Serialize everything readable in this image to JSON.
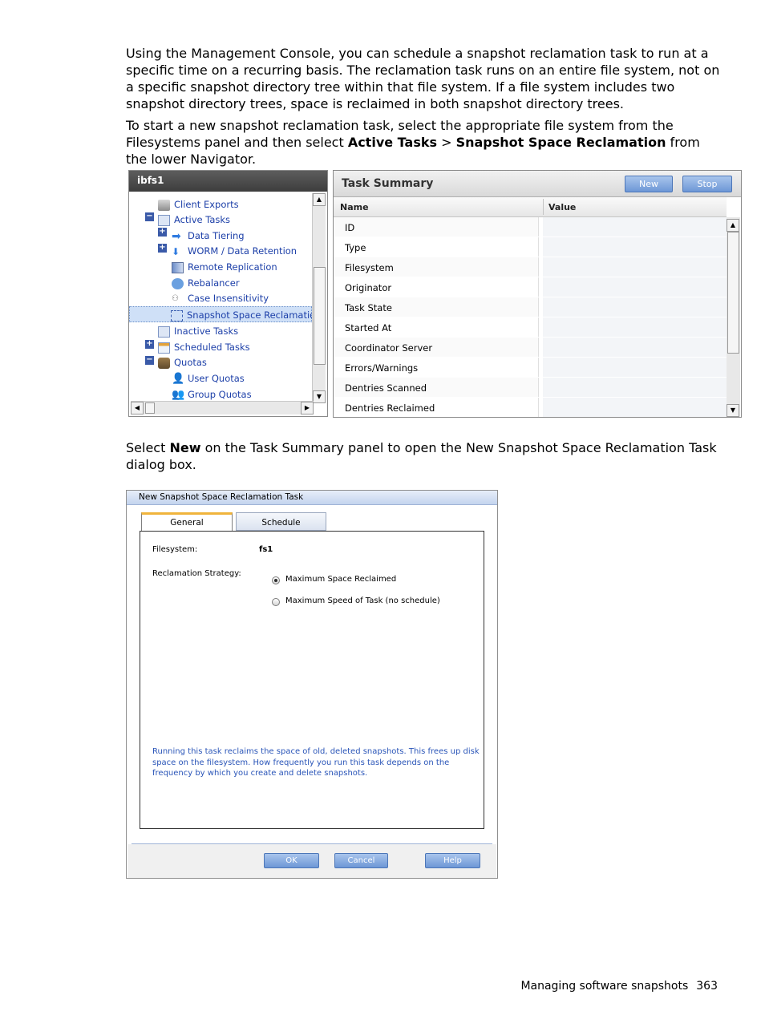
{
  "intro": {
    "para1": "Using the Management Console, you can schedule a snapshot reclamation task to run at a specific time on a recurring basis. The reclamation task runs on an entire file system, not on a specific snapshot directory tree within that file system. If a file system includes two snapshot directory trees, space is reclaimed in both snapshot directory trees.",
    "para2_start": "To start a new snapshot reclamation task, select the appropriate file system from the Filesystems panel and then select ",
    "para2_b1": "Active Tasks",
    "para2_sep": " > ",
    "para2_b2": "Snapshot Space Reclamation",
    "para2_end": " from the lower Navigator."
  },
  "navigator": {
    "header": "ibfs1",
    "items": [
      {
        "label": "Client Exports",
        "icon": "server-icon"
      },
      {
        "label": "Active Tasks",
        "icon": "tasks-icon"
      },
      {
        "label": "Data Tiering",
        "icon": "arrow-right-icon"
      },
      {
        "label": "WORM / Data Retention",
        "icon": "download-icon"
      },
      {
        "label": "Remote Replication",
        "icon": "replication-icon"
      },
      {
        "label": "Rebalancer",
        "icon": "rebalance-icon"
      },
      {
        "label": "Case Insensitivity",
        "icon": "case-icon"
      },
      {
        "label": "Snapshot Space Reclamation",
        "icon": "snapshot-icon"
      },
      {
        "label": "Inactive Tasks",
        "icon": "tasks-icon"
      },
      {
        "label": "Scheduled Tasks",
        "icon": "calendar-icon"
      },
      {
        "label": "Quotas",
        "icon": "quota-icon"
      },
      {
        "label": "User Quotas",
        "icon": "user-icon"
      },
      {
        "label": "Group Quotas",
        "icon": "group-icon"
      }
    ]
  },
  "task_summary": {
    "title": "Task Summary",
    "new_label": "New",
    "stop_label": "Stop",
    "col_name": "Name",
    "col_value": "Value",
    "rows": [
      "ID",
      "Type",
      "Filesystem",
      "Originator",
      "Task State",
      "Started At",
      "Coordinator Server",
      "Errors/Warnings",
      "Dentries Scanned",
      "Dentries Reclaimed"
    ]
  },
  "middle": {
    "text_start": "Select ",
    "text_b": "New",
    "text_end": " on the Task Summary panel to open the New Snapshot Space Reclamation Task dialog box."
  },
  "dialog": {
    "title": "New Snapshot Space Reclamation Task",
    "tab_general": "General",
    "tab_schedule": "Schedule",
    "filesystem_label": "Filesystem:",
    "filesystem_value": "fs1",
    "strategy_label": "Reclamation Strategy:",
    "option1": "Maximum Space Reclaimed",
    "option2": "Maximum Speed of Task (no schedule)",
    "info": "Running this task reclaims the space of old, deleted snapshots. This frees up disk space on the filesystem. How frequently you run this task depends on the frequency by which you create and delete snapshots.",
    "ok_label": "OK",
    "cancel_label": "Cancel",
    "help_label": "Help"
  },
  "footer": {
    "section": "Managing software snapshots",
    "page": "363"
  }
}
